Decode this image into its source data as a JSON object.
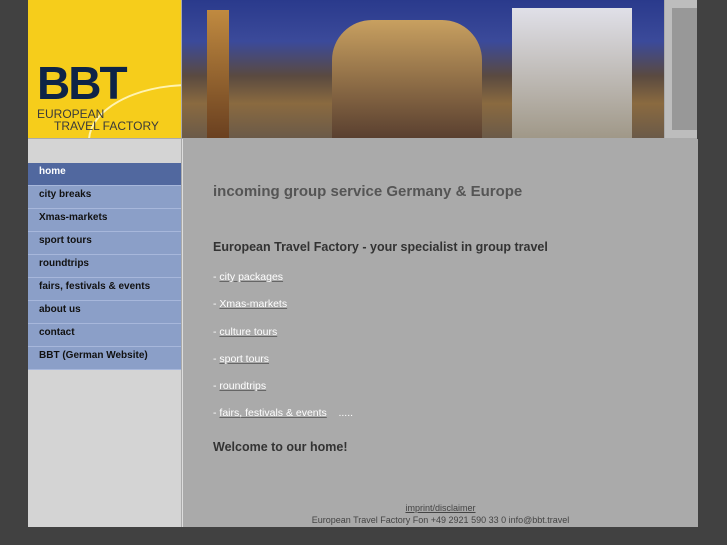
{
  "logo": {
    "brand": "BBT",
    "line1": "EUROPEAN",
    "line2": "TRAVEL FACTORY"
  },
  "nav": [
    {
      "label": "home"
    },
    {
      "label": "city breaks"
    },
    {
      "label": "Xmas-markets"
    },
    {
      "label": "sport tours"
    },
    {
      "label": "roundtrips"
    },
    {
      "label": "fairs, festivals & events"
    },
    {
      "label": "about us"
    },
    {
      "label": "contact"
    },
    {
      "label": "BBT (German Website)"
    }
  ],
  "main": {
    "heading": "incoming group service Germany & Europe",
    "subheading": "European Travel Factory - your specialist in group travel",
    "bullet": "- ",
    "links": [
      "city packages",
      "Xmas-markets",
      "culture tours",
      "sport tours",
      "roundtrips",
      "fairs, festivals & events"
    ],
    "more": ".....",
    "welcome": "Welcome to our home!"
  },
  "footer": {
    "imprint": "imprint/disclaimer",
    "contact": "European Travel Factory Fon +49 2921 590 33 0 info@bbt.travel"
  }
}
